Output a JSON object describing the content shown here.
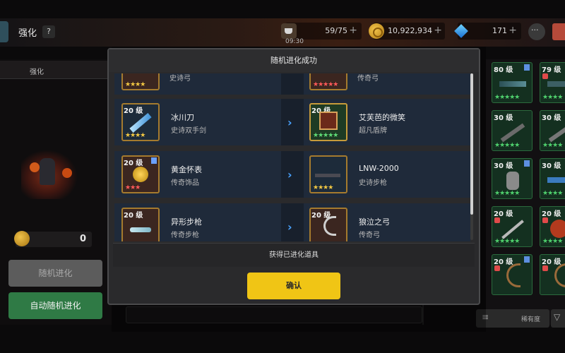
{
  "header": {
    "title": "强化",
    "help": "?",
    "stamina": "59/75",
    "time": "09:30",
    "coins": "10,922,934",
    "gems": "171",
    "plus": "+"
  },
  "left_panel": {
    "tab_label": "强化",
    "coin_value": "0",
    "random_evolve_label": "随机进化",
    "auto_random_evolve_label": "自动随机进化"
  },
  "modal": {
    "title": "随机进化成功",
    "footer": "获得已进化道具",
    "confirm_label": "确认",
    "rows": [
      {
        "left": {
          "level": "",
          "name": "",
          "type": "史诗弓",
          "stars": "★★★★",
          "star_color": "gold"
        },
        "right": {
          "level": "",
          "name": "",
          "type": "传奇弓",
          "stars": "★★★★★",
          "star_color": "red"
        }
      },
      {
        "left": {
          "level": "20 级",
          "name": "冰川刀",
          "type": "史诗双手剑",
          "stars": "★★★★",
          "star_color": "gold"
        },
        "right": {
          "level": "20 级",
          "name": "艾芙芭的微笑",
          "type": "超凡盾牌",
          "stars": "★★★★★",
          "star_color": "green"
        }
      },
      {
        "left": {
          "level": "20 级",
          "name": "黄金怀表",
          "type": "传奇饰品",
          "stars": "★★★",
          "star_color": "red"
        },
        "right": {
          "level": "",
          "name": "LNW-2000",
          "type": "史诗步枪",
          "stars": "★★★★",
          "star_color": "gold"
        }
      },
      {
        "left": {
          "level": "20 级",
          "name": "异形步枪",
          "type": "传奇步枪",
          "stars": "",
          "star_color": "red"
        },
        "right": {
          "level": "20 级",
          "name": "狼泣之弓",
          "type": "传奇弓",
          "stars": "",
          "star_color": "red"
        }
      }
    ]
  },
  "inventory": {
    "cells": [
      {
        "level": "80 级",
        "stars": "★★★★★"
      },
      {
        "level": "79 级",
        "stars": "★★★★"
      },
      {
        "level": "30 级",
        "stars": "★★★★★"
      },
      {
        "level": "30 级",
        "stars": "★★★★"
      },
      {
        "level": "30 级",
        "stars": "★★★★★"
      },
      {
        "level": "30 级",
        "stars": "★★★★"
      },
      {
        "level": "20 级",
        "stars": "★★★★★"
      },
      {
        "level": "20 级",
        "stars": "★★★★"
      },
      {
        "level": "20 级",
        "stars": ""
      },
      {
        "level": "20 级",
        "stars": ""
      }
    ],
    "sort_label": "稀有度"
  },
  "colors": {
    "accent_yellow": "#f0c515",
    "accent_green": "#2f7a45",
    "arrow_blue": "#4aa3ff"
  }
}
